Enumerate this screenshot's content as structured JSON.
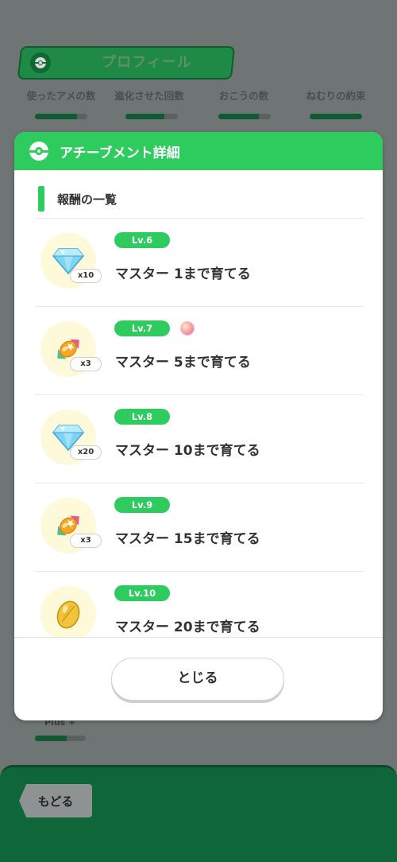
{
  "background": {
    "profile_title": "プロフィール",
    "stats": [
      {
        "label": "使ったアメの数",
        "progress": 0.8
      },
      {
        "label": "進化させた回数",
        "progress": 0.74
      },
      {
        "label": "おこうの数",
        "progress": 0.78
      },
      {
        "label": "ねむりの約束",
        "progress": 1.0
      }
    ],
    "plus_label": "Plus +",
    "plus_progress": 0.62,
    "back_label": "もどる"
  },
  "modal": {
    "title": "アチーブメント詳細",
    "section_title": "報酬の一覧",
    "rewards": [
      {
        "level": "Lv.6",
        "description": "マスター 1まで育てる",
        "icon": "diamond-icon",
        "quantity": "x10",
        "extra_icon": null
      },
      {
        "level": "Lv.7",
        "description": "マスター 5まで育てる",
        "icon": "candy-icon",
        "quantity": "x3",
        "extra_icon": "candy-dot-icon"
      },
      {
        "level": "Lv.8",
        "description": "マスター 10まで育てる",
        "icon": "diamond-icon",
        "quantity": "x20",
        "extra_icon": null
      },
      {
        "level": "Lv.9",
        "description": "マスター 15まで育てる",
        "icon": "candy-icon",
        "quantity": "x3",
        "extra_icon": null
      },
      {
        "level": "Lv.10",
        "description": "マスター 20まで育てる",
        "icon": "seed-icon",
        "quantity": "",
        "extra_icon": null
      }
    ],
    "close_label": "とじる"
  },
  "colors": {
    "accent_green": "#2ecc5f",
    "dark_green": "#0f6638",
    "overlay_gray": "#6f7574"
  }
}
